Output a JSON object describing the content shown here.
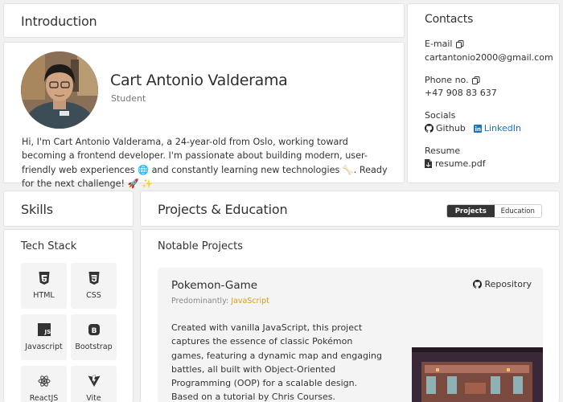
{
  "intro": {
    "title": "Introduction",
    "name": "Cart Antonio Valderama",
    "role": "Student",
    "bio": "Hi, I'm Cart Antonio Valderama, a 24-year-old from Oslo, working toward becoming a frontend developer. I'm passionate about building modern, user-friendly web experiences 🌐 and constantly learning new technologies 🦴. Ready for the next challenge! 🚀 ✨"
  },
  "contacts": {
    "title": "Contacts",
    "email_label": "E-mail",
    "email": "cartantonio2000@gmail.com",
    "phone_label": "Phone no.",
    "phone": "+47 908 83 637",
    "socials_label": "Socials",
    "github": "Github",
    "linkedin": "LinkedIn",
    "resume_label": "Resume",
    "resume_file": "resume.pdf"
  },
  "skills": {
    "title": "Skills",
    "subtitle": "Tech Stack",
    "items": [
      {
        "label": "HTML",
        "icon": "html5-icon"
      },
      {
        "label": "CSS",
        "icon": "css3-icon"
      },
      {
        "label": "Javascript",
        "icon": "javascript-icon"
      },
      {
        "label": "Bootstrap",
        "icon": "bootstrap-icon"
      },
      {
        "label": "ReactJS",
        "icon": "react-icon"
      },
      {
        "label": "Vite",
        "icon": "vite-icon"
      }
    ]
  },
  "projects": {
    "title": "Projects & Education",
    "tabs": [
      "Projects",
      "Education"
    ],
    "active_tab": "Projects",
    "subtitle": "Notable Projects",
    "items": [
      {
        "title": "Pokemon-Game",
        "lang_prefix": "Predominantly:",
        "lang": "JavaScript",
        "repo_label": "Repository",
        "description": "Created with vanilla JavaScript, this project captures the essence of classic Pokémon games, featuring a dynamic map and engaging battles, all built with Object-Oriented Programming (OOP) for a scalable design. Based on a tutorial by Chris Courses."
      }
    ]
  },
  "colors": {
    "accent_dark": "#353535",
    "link_blue": "#1a73c8",
    "js_yellow": "#d4a017"
  }
}
